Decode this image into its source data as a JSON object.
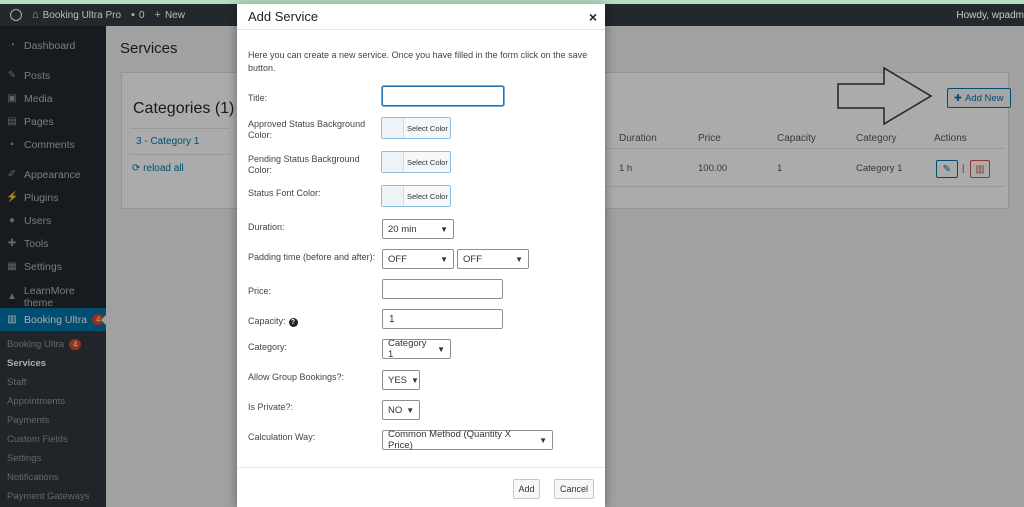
{
  "adminbar": {
    "site_name": "Booking Ultra Pro",
    "comments_count": "0",
    "new_label": "New",
    "howdy": "Howdy, wpadm"
  },
  "sidebar": {
    "items": [
      {
        "label": "Dashboard",
        "icon": "dashboard-icon"
      },
      {
        "label": "Posts",
        "icon": "pin-icon"
      },
      {
        "label": "Media",
        "icon": "media-icon"
      },
      {
        "label": "Pages",
        "icon": "pages-icon"
      },
      {
        "label": "Comments",
        "icon": "comments-icon"
      },
      {
        "label": "Appearance",
        "icon": "brush-icon"
      },
      {
        "label": "Plugins",
        "icon": "plugin-icon"
      },
      {
        "label": "Users",
        "icon": "users-icon"
      },
      {
        "label": "Tools",
        "icon": "wrench-icon"
      },
      {
        "label": "Settings",
        "icon": "settings-icon"
      },
      {
        "label": "LearnMore theme",
        "icon": "graduation-icon"
      },
      {
        "label": "Booking Ultra",
        "icon": "calendar-icon",
        "badge": "4"
      }
    ],
    "submenu": [
      {
        "label": "Booking Ultra",
        "badge": "4"
      },
      {
        "label": "Services"
      },
      {
        "label": "Staff"
      },
      {
        "label": "Appointments"
      },
      {
        "label": "Payments"
      },
      {
        "label": "Custom Fields"
      },
      {
        "label": "Settings"
      },
      {
        "label": "Notifications"
      },
      {
        "label": "Payment Gateways"
      }
    ]
  },
  "page": {
    "title": "Services",
    "categories_title": "Categories (1)",
    "category_item": "3 - Category 1",
    "reload_label": "reload all",
    "add_new_label": "Add New",
    "table_headers": [
      "Duration",
      "Price",
      "Capacity",
      "Category",
      "Actions"
    ],
    "row": {
      "duration": "1 h",
      "price": "100.00",
      "capacity": "1",
      "category": "Category 1",
      "action_sep": "|"
    }
  },
  "modal": {
    "title": "Add Service",
    "close": "×",
    "intro": "Here you can create a new service. Once you have filled in the form click on the save button.",
    "labels": {
      "title": "Title:",
      "approved_bg": "Approved Status Background Color:",
      "pending_bg": "Pending Status Background Color:",
      "font_color": "Status Font Color:",
      "duration": "Duration:",
      "padding": "Padding time (before and after):",
      "price": "Price:",
      "capacity": "Capacity:",
      "category": "Category:",
      "group": "Allow Group Bookings?:",
      "private": "Is Private?:",
      "calc": "Calculation Way:"
    },
    "select_color": "Select Color",
    "values": {
      "title": "",
      "duration": "20 min",
      "padding_before": "OFF",
      "padding_after": "OFF",
      "price": "",
      "capacity": "1",
      "category": "Category 1",
      "group": "YES",
      "private": "NO",
      "calc": "Common Method (Quantity X Price)"
    },
    "buttons": {
      "add": "Add",
      "cancel": "Cancel"
    }
  },
  "colors": {
    "accent": "#0073aa",
    "sidebar_bg": "#23282d",
    "danger": "#d9534f"
  }
}
